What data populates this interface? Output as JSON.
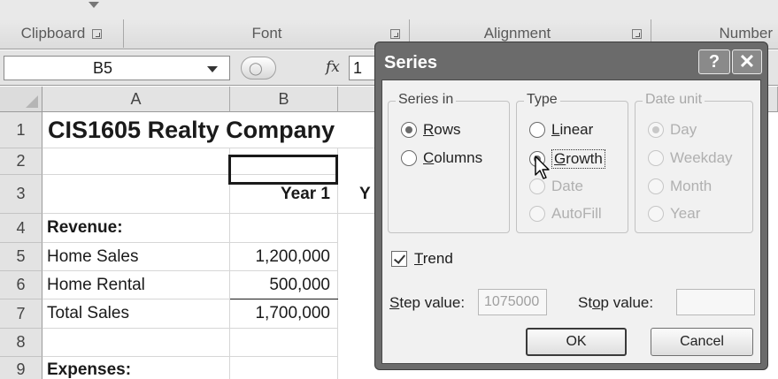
{
  "ribbon": {
    "groups": [
      {
        "label": "Clipboard",
        "has_launcher": true
      },
      {
        "label": "Font",
        "has_launcher": false
      },
      {
        "label": "Alignment",
        "has_launcher": true
      },
      {
        "label": "Number",
        "has_launcher": false
      }
    ]
  },
  "formula_bar": {
    "name_box": "B5",
    "fx_label": "fx",
    "value": "1"
  },
  "sheet": {
    "columns": [
      "A",
      "B"
    ],
    "rows": [
      "1",
      "2",
      "3",
      "4",
      "5",
      "6",
      "7",
      "8",
      "9"
    ],
    "title": "CIS1605 Realty Company",
    "year1_header": "Year 1",
    "year_partial": "Y",
    "revenue_label": "Revenue:",
    "home_sales_label": "Home Sales",
    "home_sales_value": "1,200,000",
    "home_rental_label": "Home Rental",
    "home_rental_value": "500,000",
    "total_sales_label": "Total Sales",
    "total_sales_value": "1,700,000",
    "expenses_label": "Expenses:"
  },
  "dialog": {
    "title": "Series",
    "help_label": "?",
    "close_label": "✕",
    "series_in": {
      "legend": "Series in",
      "rows": "Rows",
      "columns": "Columns",
      "selected": "Rows"
    },
    "type": {
      "legend": "Type",
      "linear": "Linear",
      "growth": "Growth",
      "date": "Date",
      "autofill": "AutoFill",
      "selected": "Growth"
    },
    "date_unit": {
      "legend": "Date unit",
      "day": "Day",
      "weekday": "Weekday",
      "month": "Month",
      "year": "Year",
      "selected": "Day",
      "disabled": true
    },
    "trend_label": "Trend",
    "trend_checked": true,
    "step_label": "Step value:",
    "step_value": "1075000",
    "stop_label": "Stop value:",
    "stop_value": "",
    "ok_label": "OK",
    "cancel_label": "Cancel"
  }
}
